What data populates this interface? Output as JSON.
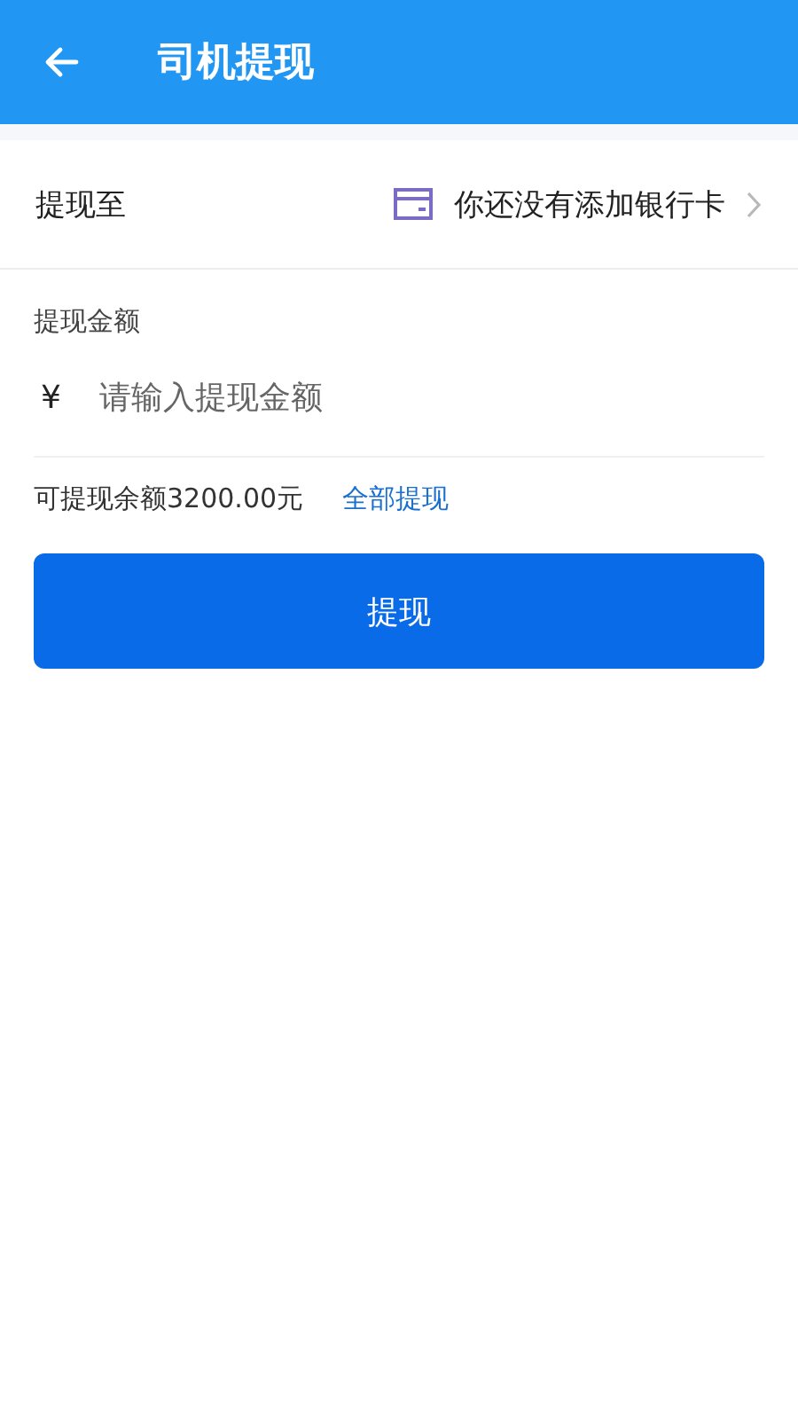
{
  "header": {
    "title": "司机提现"
  },
  "withdraw_to": {
    "label": "提现至",
    "value": "你还没有添加银行卡"
  },
  "amount": {
    "label": "提现金额",
    "currency": "¥",
    "placeholder": "请输入提现金额"
  },
  "balance": {
    "text": "可提现余额3200.00元",
    "link": "全部提现"
  },
  "submit_button": "提现"
}
